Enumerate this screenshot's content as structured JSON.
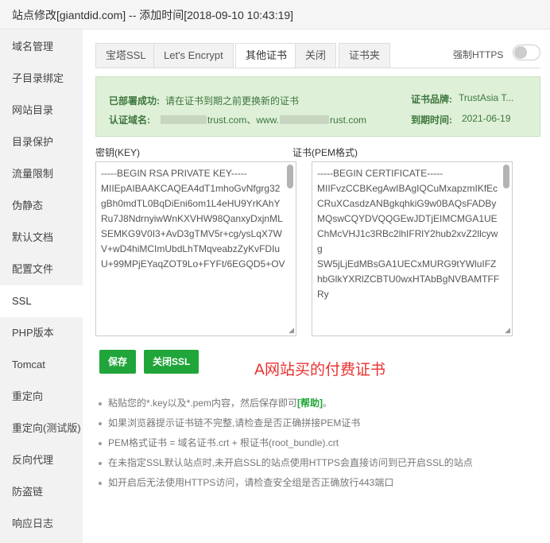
{
  "window": {
    "title": "站点修改[giantdid.com] -- 添加时间[2018-09-10 10:43:19]"
  },
  "sidebar": {
    "items": [
      {
        "label": "域名管理"
      },
      {
        "label": "子目录绑定"
      },
      {
        "label": "网站目录"
      },
      {
        "label": "目录保护"
      },
      {
        "label": "流量限制"
      },
      {
        "label": "伪静态"
      },
      {
        "label": "默认文档"
      },
      {
        "label": "配置文件"
      },
      {
        "label": "SSL"
      },
      {
        "label": "PHP版本"
      },
      {
        "label": "Tomcat"
      },
      {
        "label": "重定向"
      },
      {
        "label": "重定向(测试版)"
      },
      {
        "label": "反向代理"
      },
      {
        "label": "防盗链"
      },
      {
        "label": "响应日志"
      }
    ],
    "active": "SSL"
  },
  "tabs": [
    {
      "label": "宝塔SSL"
    },
    {
      "label": "Let's Encrypt"
    },
    {
      "label": "其他证书"
    },
    {
      "label": "关闭"
    },
    {
      "label": "证书夹"
    }
  ],
  "active_tab": "其他证书",
  "force_https": {
    "label": "强制HTTPS",
    "enabled": false
  },
  "status": {
    "deployed_label": "已部署成功:",
    "deployed_text": "请在证书到期之前更换新的证书",
    "domain_label": "认证域名:",
    "domain_part1": "trust.com、www.",
    "domain_part2": "rust.com",
    "brand_label": "证书品牌:",
    "brand_value": "TrustAsia T...",
    "expiry_label": "到期时间:",
    "expiry_value": "2021-06-19"
  },
  "key_field": {
    "label": "密钥(KEY)",
    "value": "-----BEGIN RSA PRIVATE KEY-----\nMIIEpAIBAAKCAQEA4dT1mhoGvNfgrg32gBh0mdTL0BqDiEni6om1L4eHU9YrKAhY\nRu7J8NdrnyiwWnKXVHW98QanxyDxjnMLSEMKG9V0I3+AvD3gTMV5r+cg/ysLqX7W\nV+wD4hiMCImUbdLhTMqveabzZyKvFDIuU+99MPjEYaqZOT9Lo+FYFt/6EGQD5+OV"
  },
  "cert_field": {
    "label": "证书(PEM格式)",
    "value": "-----BEGIN CERTIFICATE-----\nMIIFvzCCBKegAwIBAgIQCuMxapzmIKfEcCRuXCasdzANBgkqhkiG9w0BAQsFADBy\nMQswCQYDVQQGEwJDTjEIMCMGA1UEChMcVHJ1c3RBc2lhIFRlY2hub2xvZ2llcywg\nSW5jLjEdMBsGA1UECxMURG9tYWluIFZhbGlkYXRlZCBTU0wxHTAbBgNVBAMTFFRy"
  },
  "buttons": {
    "save": "保存",
    "close_ssl": "关闭SSL"
  },
  "annotation": "A网站买的付费证书",
  "tips": {
    "tip1_text": "粘贴您的*.key以及*.pem内容，然后保存即可",
    "tip1_link": "[帮助]",
    "tip1_end": "。",
    "tip2": "如果浏览器提示证书链不完整,请检查是否正确拼接PEM证书",
    "tip3": "PEM格式证书 = 域名证书.crt + 根证书(root_bundle).crt",
    "tip4": "在未指定SSL默认站点时,未开启SSL的站点使用HTTPS会直接访问到已开启SSL的站点",
    "tip5": "如开启后无法使用HTTPS访问，请检查安全组是否正确放行443端口"
  }
}
